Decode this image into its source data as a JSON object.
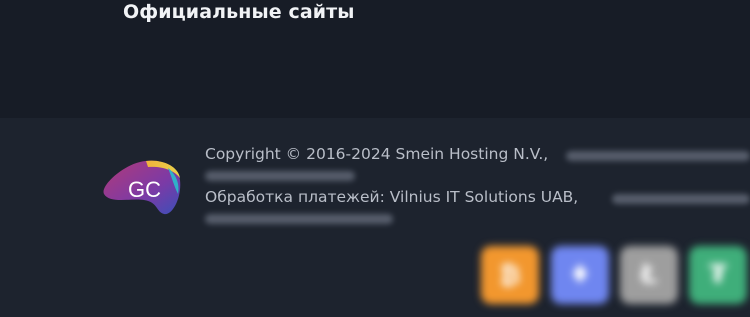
{
  "heading": "Официальные сайты",
  "logo": {
    "text": "GC"
  },
  "footer": {
    "copyright_line": "Copyright © 2016-2024 Smein Hosting N.V.,",
    "payments_line": "Обработка платежей: Vilnius IT Solutions UAB,"
  },
  "payment_methods": [
    {
      "name": "bitcoin-icon",
      "color": "#f2972e",
      "glyph": "₿"
    },
    {
      "name": "ethereum-icon",
      "color": "#6f86f0",
      "glyph": "♦"
    },
    {
      "name": "litecoin-icon",
      "color": "#9e9e9e",
      "glyph": "Ł"
    },
    {
      "name": "tether-icon",
      "color": "#3fae7a",
      "glyph": "₮"
    }
  ]
}
